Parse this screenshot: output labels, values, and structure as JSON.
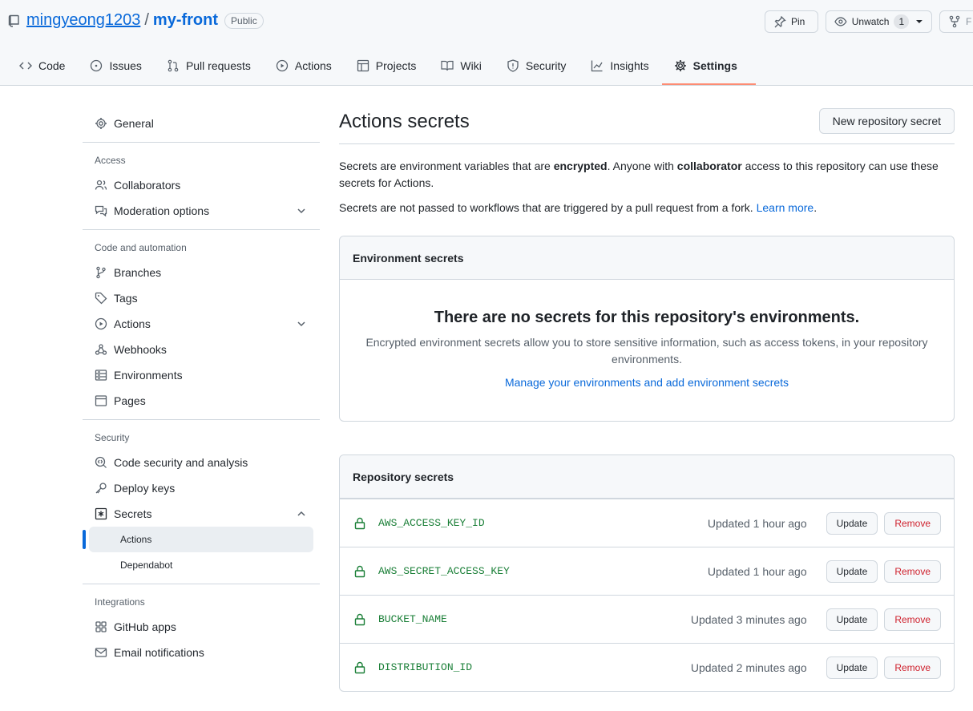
{
  "repo": {
    "owner": "mingyeong1203",
    "separator": "/",
    "name": "my-front",
    "visibility": "Public"
  },
  "header_actions": {
    "pin": "Pin",
    "watch": "Unwatch",
    "watch_count": "1",
    "fork": "F"
  },
  "tabs": [
    {
      "label": "Code",
      "icon": "code-icon"
    },
    {
      "label": "Issues",
      "icon": "issue-icon"
    },
    {
      "label": "Pull requests",
      "icon": "pull-request-icon"
    },
    {
      "label": "Actions",
      "icon": "play-icon"
    },
    {
      "label": "Projects",
      "icon": "table-icon"
    },
    {
      "label": "Wiki",
      "icon": "book-icon"
    },
    {
      "label": "Security",
      "icon": "shield-icon"
    },
    {
      "label": "Insights",
      "icon": "graph-icon"
    },
    {
      "label": "Settings",
      "icon": "gear-icon",
      "selected": true
    }
  ],
  "sidebar": {
    "general": "General",
    "access": {
      "title": "Access",
      "collaborators": "Collaborators",
      "moderation": "Moderation options"
    },
    "code_automation": {
      "title": "Code and automation",
      "branches": "Branches",
      "tags": "Tags",
      "actions": "Actions",
      "webhooks": "Webhooks",
      "environments": "Environments",
      "pages": "Pages"
    },
    "security": {
      "title": "Security",
      "code_security": "Code security and analysis",
      "deploy_keys": "Deploy keys",
      "secrets": "Secrets",
      "secrets_actions": "Actions",
      "secrets_dependabot": "Dependabot"
    },
    "integrations": {
      "title": "Integrations",
      "github_apps": "GitHub apps",
      "email_notifications": "Email notifications"
    }
  },
  "main": {
    "title": "Actions secrets",
    "new_secret_button": "New repository secret",
    "desc_1a": "Secrets are environment variables that are ",
    "desc_1b": "encrypted",
    "desc_1c": ". Anyone with ",
    "desc_1d": "collaborator",
    "desc_1e": " access to this repository can use these secrets for Actions.",
    "desc_2": "Secrets are not passed to workflows that are triggered by a pull request from a fork. ",
    "learn_more": "Learn more",
    "desc_2_end": ".",
    "env_secrets": {
      "title": "Environment secrets",
      "blank_title": "There are no secrets for this repository's environments.",
      "blank_desc": "Encrypted environment secrets allow you to store sensitive information, such as access tokens, in your repository environments.",
      "manage_link": "Manage your environments and add environment secrets"
    },
    "repo_secrets": {
      "title": "Repository secrets",
      "update_label": "Update",
      "remove_label": "Remove",
      "items": [
        {
          "name": "AWS_ACCESS_KEY_ID",
          "updated": "Updated 1 hour ago"
        },
        {
          "name": "AWS_SECRET_ACCESS_KEY",
          "updated": "Updated 1 hour ago"
        },
        {
          "name": "BUCKET_NAME",
          "updated": "Updated 3 minutes ago"
        },
        {
          "name": "DISTRIBUTION_ID",
          "updated": "Updated 2 minutes ago"
        }
      ]
    }
  },
  "colors": {
    "accent": "#0969da",
    "secret_green": "#1a7f37",
    "danger": "#cf222e",
    "tab_underline": "#fd8c73"
  }
}
